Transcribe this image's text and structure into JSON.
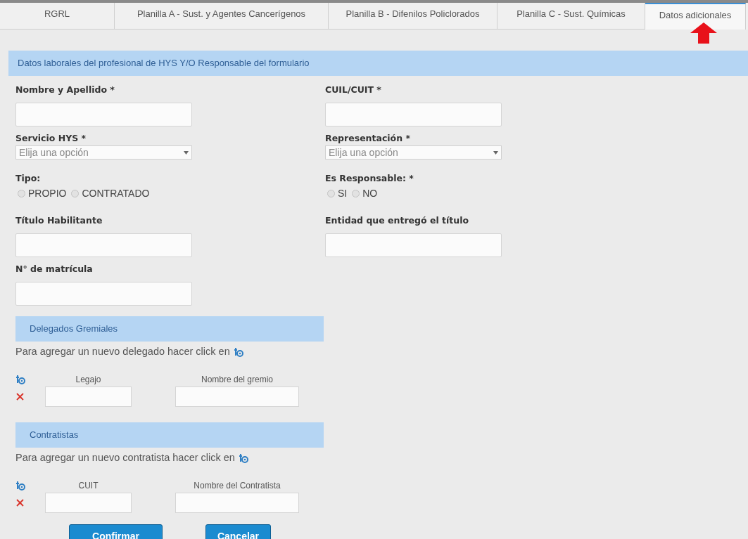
{
  "tabs": [
    {
      "label": "RGRL",
      "selected": false
    },
    {
      "label": "Planilla A - Sust. y Agentes Cancerígenos",
      "selected": false
    },
    {
      "label": "Planilla B - Difenilos Policlorados",
      "selected": false
    },
    {
      "label": "Planilla C - Sust. Químicas",
      "selected": false
    },
    {
      "label": "Datos adicionales",
      "selected": true
    }
  ],
  "section_title": "Datos laborales del profesional de HYS Y/O Responsable del formulario",
  "rows": [
    [
      {
        "kind": "text",
        "label": "Nombre y Apellido *"
      },
      {
        "kind": "text",
        "label": "CUIL/CUIT *"
      }
    ],
    [
      {
        "kind": "select",
        "label": "Servicio HYS *",
        "placeholder": "Elija una opción"
      },
      {
        "kind": "select",
        "label": "Representación *",
        "placeholder": "Elija una opción"
      }
    ],
    [
      {
        "kind": "radio",
        "label": "Tipo:",
        "options": [
          {
            "label": "PROPIO",
            "selected": false
          },
          {
            "label": "CONTRATADO",
            "selected": false
          }
        ]
      },
      {
        "kind": "radio",
        "label": "Es Responsable: *",
        "options": [
          {
            "label": "SI",
            "selected": false
          },
          {
            "label": "NO",
            "selected": false
          }
        ]
      }
    ],
    [
      {
        "kind": "text",
        "label": "Título Habilitante"
      },
      {
        "kind": "text",
        "label": "Entidad que entregó el título"
      }
    ],
    [
      {
        "kind": "text",
        "label": "N° de matrícula"
      }
    ]
  ],
  "subsections": [
    {
      "title": "Delegados Gremiales",
      "hint": "Para agregar un nuevo delegado hacer click en",
      "columns": [
        "Legajo",
        "Nombre del gremio"
      ]
    },
    {
      "title": "Contratistas",
      "hint": "Para agregar un nuevo contratista hacer click en",
      "columns": [
        "CUIT",
        "Nombre del Contratista"
      ]
    }
  ],
  "buttons": [
    "Confirmar",
    "Cancelar"
  ]
}
